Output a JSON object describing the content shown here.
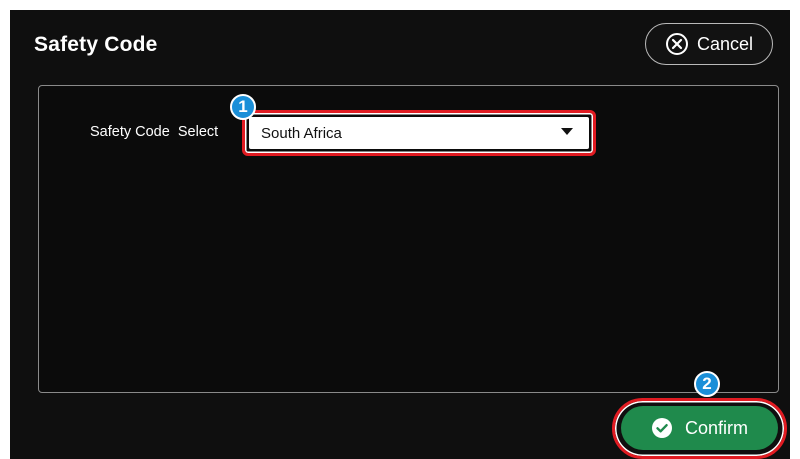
{
  "dialog": {
    "title": "Safety Code",
    "cancel_label": "Cancel",
    "confirm_label": "Confirm"
  },
  "form": {
    "safety_code_label": "Safety Code  Select",
    "safety_code_value": "South Africa"
  },
  "annotations": {
    "step1": "1",
    "step2": "2"
  },
  "icons": {
    "cancel": "circle-x-icon",
    "confirm": "circle-check-icon",
    "dropdown": "caret-down-icon"
  },
  "colors": {
    "background": "#0f0f0f",
    "confirm_green": "#1f8a4c",
    "highlight_red": "#e11b22",
    "badge_blue": "#1a8fd8"
  }
}
